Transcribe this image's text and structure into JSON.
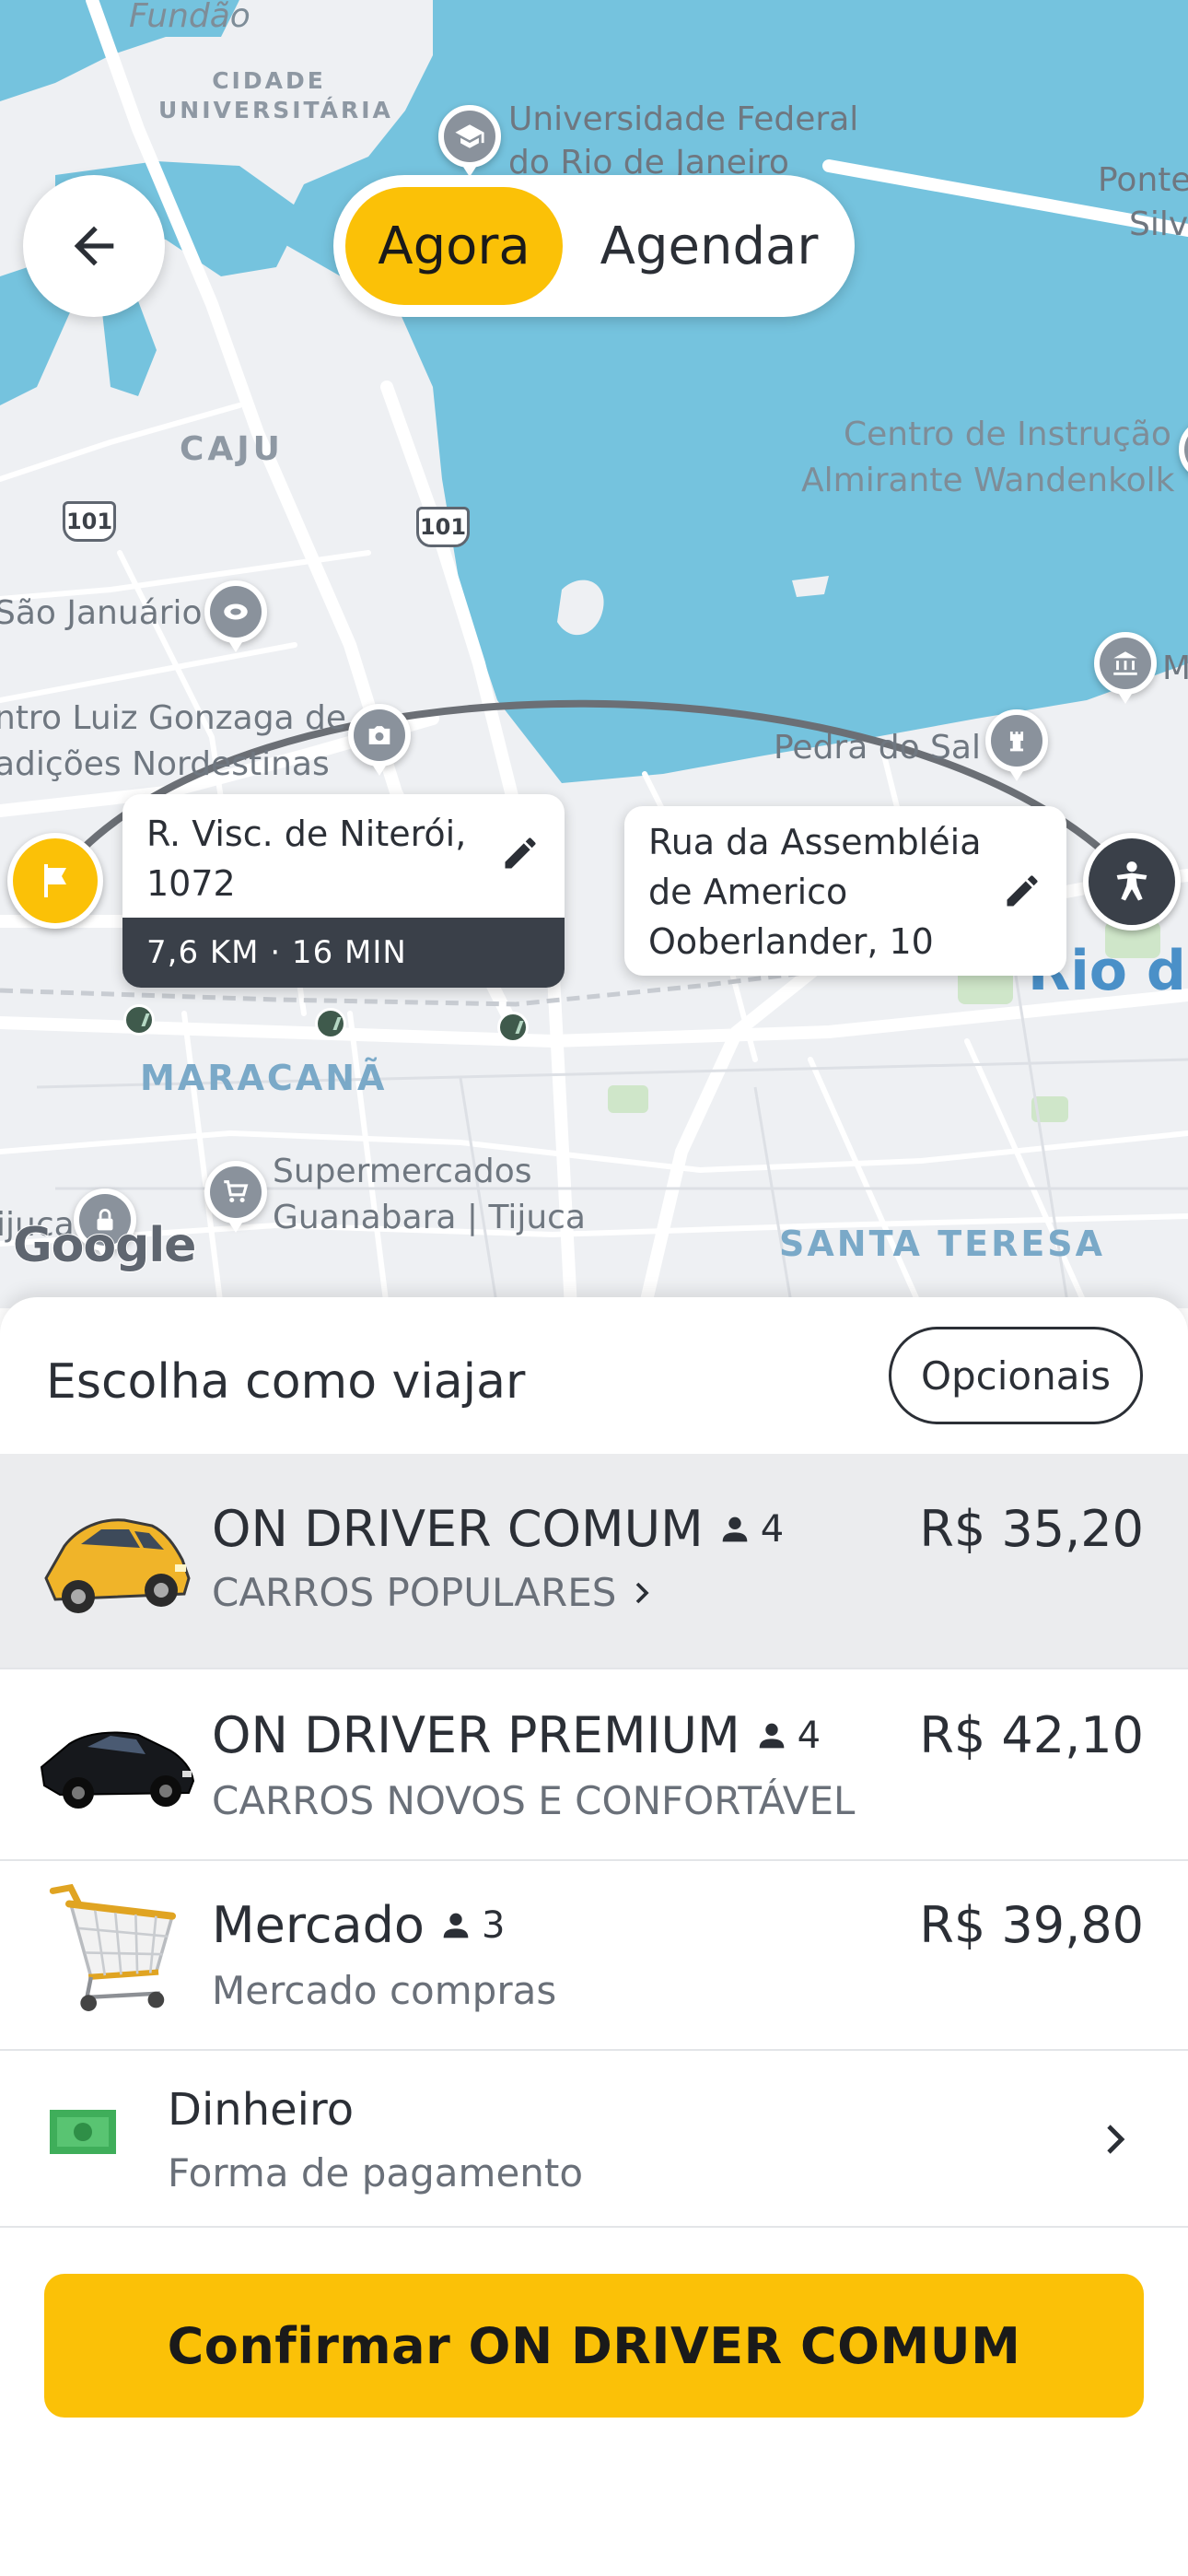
{
  "map": {
    "labels": {
      "fundao": "Fundão",
      "cidade_universitaria": "CIDADE UNIVERSITÁRIA",
      "ufrj_line1": "Universidade Federal",
      "ufrj_line2": "do Rio de Janeiro",
      "ponte_line1": "Ponte",
      "ponte_line2": "Silv",
      "caju": "CAJU",
      "centro_instrucao_line1": "Centro de Instrução",
      "centro_instrucao_line2": "Almirante Wandenkolk",
      "sao_januario": "São Januário",
      "luiz_gonzaga_line1": "ntro Luiz Gonzaga de",
      "luiz_gonzaga_line2": "adições Nordestinas",
      "pedra_do_sal": "Pedra do Sal",
      "maracana": "MARACANÃ",
      "supermercados_line1": "Supermercados",
      "supermercados_line2": "Guanabara | Tijuca",
      "santa_teresa": "SANTA TERESA",
      "rio": "Rio de",
      "ijuca": "ijuca",
      "m_letter": "M",
      "route_101_a": "101",
      "route_101_b": "101",
      "google": "Google"
    },
    "mode_toggle": {
      "active": "Agora",
      "inactive": "Agendar"
    },
    "origin": {
      "address": "R. Visc. de Niterói, 1072",
      "eta": "7,6 KM · 16 MIN"
    },
    "destination": {
      "address": "Rua da Assembléia de Americo Ooberlander, 10"
    }
  },
  "sheet": {
    "title": "Escolha como viajar",
    "options_button": "Opcionais",
    "rides": [
      {
        "name": "ON DRIVER COMUM",
        "seats": "4",
        "description": "CARROS POPULARES",
        "price": "R$ 35,20",
        "selected": true,
        "icon": "yellow-car-icon",
        "has_chevron": true
      },
      {
        "name": "ON DRIVER PREMIUM",
        "seats": "4",
        "description": "CARROS NOVOS E CONFORTÁVEL",
        "price": "R$ 42,10",
        "selected": false,
        "icon": "black-car-icon",
        "has_chevron": false
      },
      {
        "name": "Mercado",
        "seats": "3",
        "description": "Mercado compras",
        "price": "R$ 39,80",
        "selected": false,
        "icon": "shopping-cart-icon",
        "has_chevron": false
      }
    ],
    "payment": {
      "method": "Dinheiro",
      "label": "Forma de pagamento",
      "icon": "cash-icon"
    },
    "confirm_button": "Confirmar ON DRIVER COMUM"
  },
  "colors": {
    "accent": "#fbc107",
    "water": "#75c3de",
    "map_land": "#eef0f3",
    "eta_bg": "#3a4049",
    "selected_row": "#ebecee",
    "text_primary": "#2b2f36",
    "text_secondary": "#6a7079"
  }
}
